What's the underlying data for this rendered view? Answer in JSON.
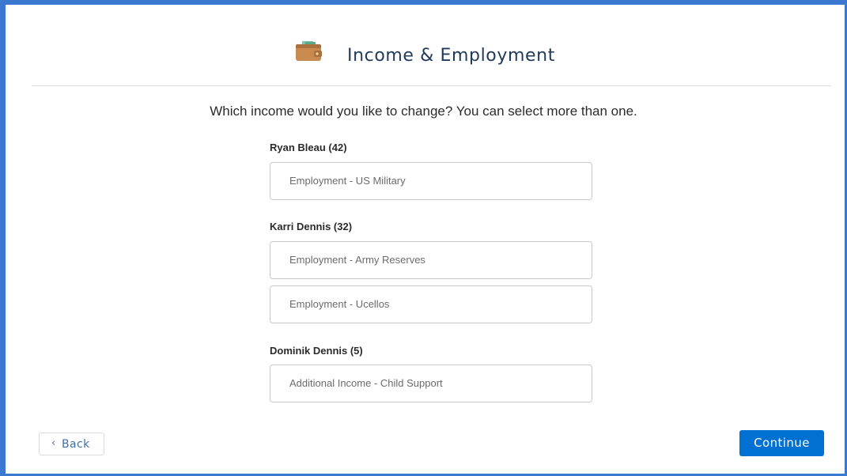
{
  "header": {
    "title": "Income & Employment",
    "icon": "wallet-icon"
  },
  "question": "Which income would you like to change? You can select more than one.",
  "people": [
    {
      "name": "Ryan Bleau (42)",
      "options": [
        "Employment - US Military"
      ]
    },
    {
      "name": "Karri Dennis (32)",
      "options": [
        "Employment - Army Reserves",
        "Employment - Ucellos"
      ]
    },
    {
      "name": "Dominik Dennis (5)",
      "options": [
        "Additional Income - Child Support"
      ]
    }
  ],
  "footer": {
    "back_chevron": "‹",
    "back_label": "Back",
    "continue_label": "Continue"
  },
  "colors": {
    "frame_border": "#3b78cf",
    "primary_button": "#0070d2",
    "title_text": "#1f3a5a"
  }
}
